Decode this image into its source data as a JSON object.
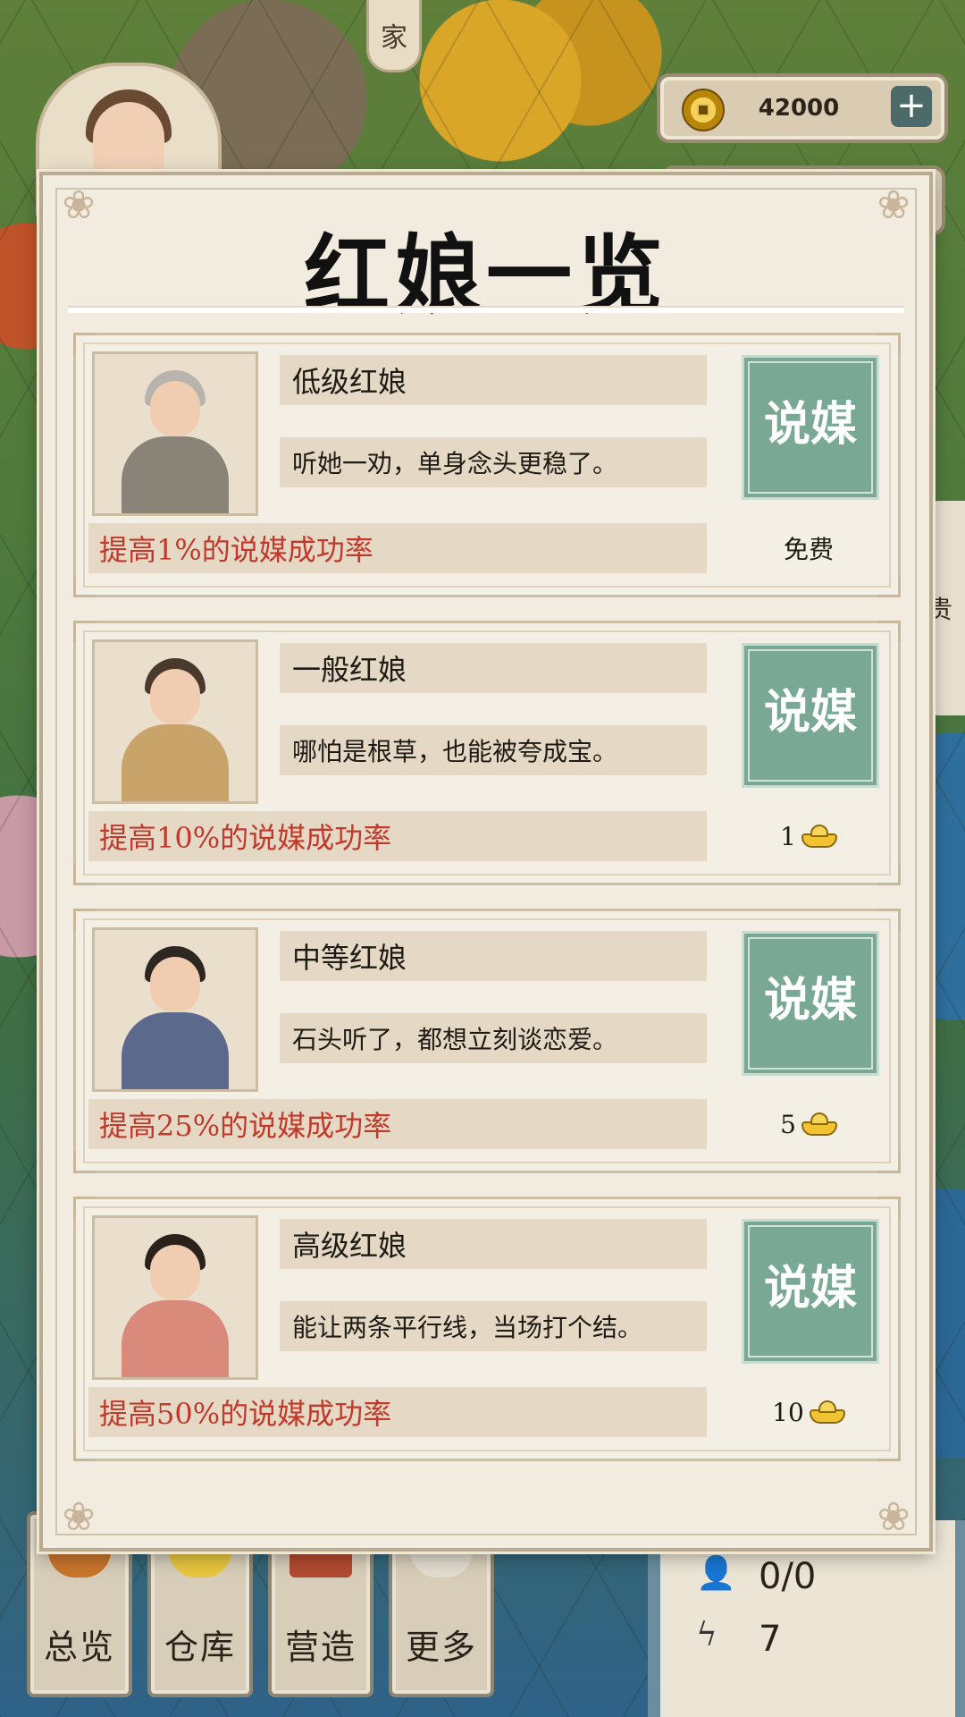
{
  "top_tag": "家",
  "currency": {
    "amount": "42000",
    "plus": "+"
  },
  "side_tab": "贵",
  "modal": {
    "title": "红娘一览",
    "cards": [
      {
        "name": "低级红娘",
        "desc": "听她一劝，单身念头更稳了。",
        "effect": "提高1%的说媒成功率",
        "button": "说媒",
        "cost": "免费",
        "cost_icon": ""
      },
      {
        "name": "一般红娘",
        "desc": "哪怕是根草，也能被夸成宝。",
        "effect": "提高10%的说媒成功率",
        "button": "说媒",
        "cost": "1",
        "cost_icon": "gold-ingot-icon"
      },
      {
        "name": "中等红娘",
        "desc": "石头听了，都想立刻谈恋爱。",
        "effect": "提高25%的说媒成功率",
        "button": "说媒",
        "cost": "5",
        "cost_icon": "gold-ingot-icon"
      },
      {
        "name": "高级红娘",
        "desc": "能让两条平行线，当场打个结。",
        "effect": "提高50%的说媒成功率",
        "button": "说媒",
        "cost": "10",
        "cost_icon": "gold-ingot-icon"
      }
    ]
  },
  "bottom_nav": [
    {
      "label": "总览"
    },
    {
      "label": "仓库"
    },
    {
      "label": "营造"
    },
    {
      "label": "更多"
    }
  ],
  "status": {
    "workers": "0/0",
    "energy": "7"
  },
  "colors": {
    "effect_text": "#c0392b",
    "match_button": "#79a895",
    "panel_bg": "#f2ece0"
  }
}
